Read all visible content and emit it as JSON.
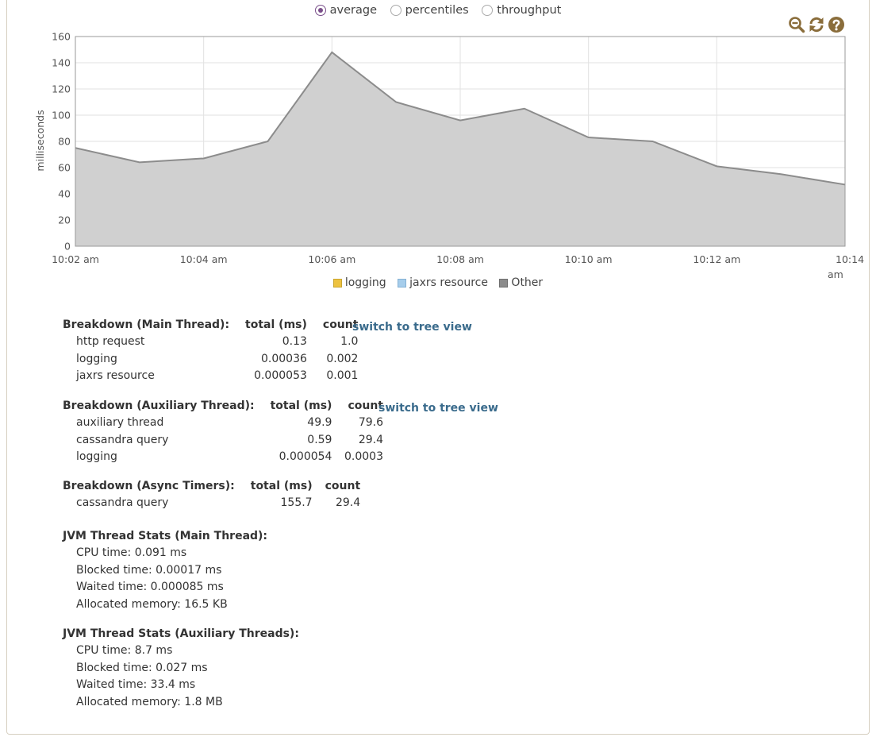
{
  "radio_options": [
    {
      "label": "average",
      "checked": true
    },
    {
      "label": "percentiles",
      "checked": false
    },
    {
      "label": "throughput",
      "checked": false
    }
  ],
  "toolbar": [
    "zoom-out-icon",
    "refresh-icon",
    "help-icon"
  ],
  "chart_data": {
    "type": "area",
    "ylabel": "milliseconds",
    "ylim": [
      0,
      160
    ],
    "yticks": [
      0,
      20,
      40,
      60,
      80,
      100,
      120,
      140,
      160
    ],
    "xticks": [
      "10:02 am",
      "10:04 am",
      "10:06 am",
      "10:08 am",
      "10:10 am",
      "10:12 am",
      "10:14 am"
    ],
    "x": [
      "10:02 am",
      "10:03 am",
      "10:04 am",
      "10:05 am",
      "10:06 am",
      "10:07 am",
      "10:08 am",
      "10:09 am",
      "10:10 am",
      "10:11 am",
      "10:12 am",
      "10:13 am",
      "10:14 am"
    ],
    "grid": true,
    "legend_position": "bottom",
    "series": [
      {
        "name": "logging",
        "color": "#edc240",
        "values": [
          0,
          0,
          0,
          0,
          0,
          0,
          0,
          0,
          0,
          0,
          0,
          0,
          0
        ]
      },
      {
        "name": "jaxrs resource",
        "color": "#a6cdeb",
        "values": [
          0,
          0,
          0,
          0,
          0,
          0,
          0,
          0,
          0,
          0,
          0,
          0,
          0
        ]
      },
      {
        "name": "Other",
        "color": "#8c8c8c",
        "values": [
          75,
          64,
          67,
          80,
          148,
          110,
          96,
          105,
          83,
          80,
          61,
          55,
          47
        ]
      }
    ]
  },
  "breakdowns": [
    {
      "title": "Breakdown (Main Thread):",
      "col_total": "total (ms)",
      "col_count": "count",
      "link": "switch to tree view",
      "rows": [
        {
          "name": "http request",
          "total": "0.13",
          "count": "1.0"
        },
        {
          "name": "logging",
          "total": "0.00036",
          "count": "0.002"
        },
        {
          "name": "jaxrs resource",
          "total": "0.000053",
          "count": "0.001"
        }
      ]
    },
    {
      "title": "Breakdown (Auxiliary Thread):",
      "col_total": "total (ms)",
      "col_count": "count",
      "link": "switch to tree view",
      "rows": [
        {
          "name": "auxiliary thread",
          "total": "49.9",
          "count": "79.6"
        },
        {
          "name": "cassandra query",
          "total": "0.59",
          "count": "29.4"
        },
        {
          "name": "logging",
          "total": "0.000054",
          "count": "0.0003"
        }
      ]
    },
    {
      "title": "Breakdown (Async Timers):",
      "col_total": "total (ms)",
      "col_count": "count",
      "rows": [
        {
          "name": "cassandra query",
          "total": "155.7",
          "count": "29.4"
        }
      ]
    }
  ],
  "jvm_main": {
    "heading": "JVM Thread Stats (Main Thread):",
    "lines": [
      "CPU time: 0.091 ms",
      "Blocked time: 0.00017 ms",
      "Waited time: 0.000085 ms",
      "Allocated memory: 16.5 KB"
    ]
  },
  "jvm_aux": {
    "heading": "JVM Thread Stats (Auxiliary Threads):",
    "lines": [
      "CPU time: 8.7 ms",
      "Blocked time: 0.027 ms",
      "Waited time: 33.4 ms",
      "Allocated memory: 1.8 MB"
    ]
  }
}
